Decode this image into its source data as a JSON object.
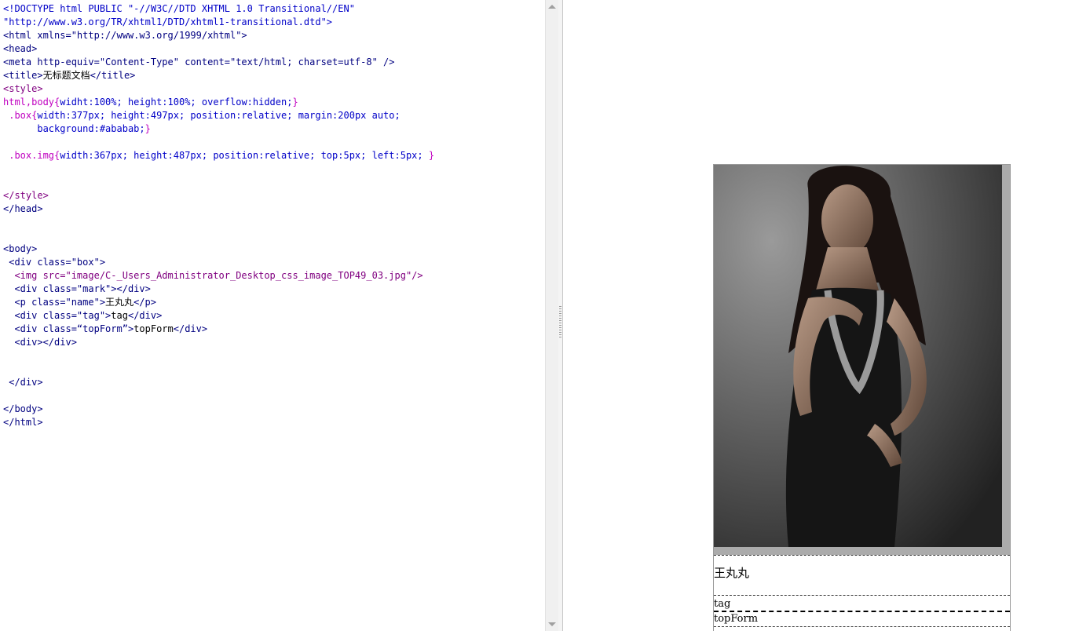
{
  "editor": {
    "lines": [
      [
        {
          "t": "<!DOCTYPE html PUBLIC \"-//W3C//DTD XHTML 1.0 Transitional//EN\"",
          "c": "c-blue"
        }
      ],
      [
        {
          "t": "\"http://www.w3.org/TR/xhtml1/DTD/xhtml1-transitional.dtd\">",
          "c": "c-blue"
        }
      ],
      [
        {
          "t": "<html xmlns=\"http://www.w3.org/1999/xhtml\">",
          "c": "c-navy"
        }
      ],
      [
        {
          "t": "<head>",
          "c": "c-navy"
        }
      ],
      [
        {
          "t": "<meta http-equiv=\"Content-Type\" content=\"text/html; charset=utf-8\" />",
          "c": "c-navy"
        }
      ],
      [
        {
          "t": "<title>",
          "c": "c-navy"
        },
        {
          "t": "无标题文档",
          "c": "c-black"
        },
        {
          "t": "</title>",
          "c": "c-navy"
        }
      ],
      [
        {
          "t": "<style>",
          "c": "c-purple"
        }
      ],
      [
        {
          "t": "html,body{",
          "c": "c-mag"
        },
        {
          "t": "widht:100%; height:100%; overflow:hidden;",
          "c": "c-blue"
        },
        {
          "t": "}",
          "c": "c-mag"
        }
      ],
      [
        {
          "t": " .box{",
          "c": "c-mag"
        },
        {
          "t": "width:377px; height:497px; position:relative; margin:200px auto;",
          "c": "c-blue"
        }
      ],
      [
        {
          "t": "      background:#ababab;",
          "c": "c-blue"
        },
        {
          "t": "}",
          "c": "c-mag"
        }
      ],
      [
        {
          "t": "",
          "c": "c-black"
        }
      ],
      [
        {
          "t": " .box.img{",
          "c": "c-mag"
        },
        {
          "t": "width:367px; height:487px; position:relative; top:5px; left:5px; ",
          "c": "c-blue"
        },
        {
          "t": "}",
          "c": "c-mag"
        }
      ],
      [
        {
          "t": "",
          "c": "c-black"
        }
      ],
      [
        {
          "t": "",
          "c": "c-black"
        }
      ],
      [
        {
          "t": "</style>",
          "c": "c-purple"
        }
      ],
      [
        {
          "t": "</head>",
          "c": "c-navy"
        }
      ],
      [
        {
          "t": "",
          "c": "c-black"
        }
      ],
      [
        {
          "t": "",
          "c": "c-black"
        }
      ],
      [
        {
          "t": "<body>",
          "c": "c-navy"
        }
      ],
      [
        {
          "t": " <div class=\"box\">",
          "c": "c-navy"
        }
      ],
      [
        {
          "t": "  <img src=\"image/C-_Users_Administrator_Desktop_css_image_TOP49_03.jpg\"/>",
          "c": "c-purple"
        }
      ],
      [
        {
          "t": "  <div class=\"mark\"></div>",
          "c": "c-navy"
        }
      ],
      [
        {
          "t": "  <p class=\"name\">",
          "c": "c-navy"
        },
        {
          "t": "王丸丸",
          "c": "c-black"
        },
        {
          "t": "</p>",
          "c": "c-navy"
        }
      ],
      [
        {
          "t": "  <div class=\"tag\">",
          "c": "c-navy"
        },
        {
          "t": "tag",
          "c": "c-black"
        },
        {
          "t": "</div>",
          "c": "c-navy"
        }
      ],
      [
        {
          "t": "  <div class=“topForm”>",
          "c": "c-navy"
        },
        {
          "t": "topForm",
          "c": "c-black"
        },
        {
          "t": "</div>",
          "c": "c-navy"
        }
      ],
      [
        {
          "t": "  <div></div>",
          "c": "c-navy"
        }
      ],
      [
        {
          "t": "",
          "c": "c-black"
        }
      ],
      [
        {
          "t": "",
          "c": "c-black"
        }
      ],
      [
        {
          "t": " </div>",
          "c": "c-navy"
        }
      ],
      [
        {
          "t": "",
          "c": "c-black"
        }
      ],
      [
        {
          "t": "</body>",
          "c": "c-navy"
        }
      ],
      [
        {
          "t": "</html>",
          "c": "c-navy"
        }
      ]
    ]
  },
  "preview": {
    "name": "王丸丸",
    "tag": "tag",
    "topform": "topForm"
  },
  "colors": {
    "box_background": "#ababab"
  }
}
